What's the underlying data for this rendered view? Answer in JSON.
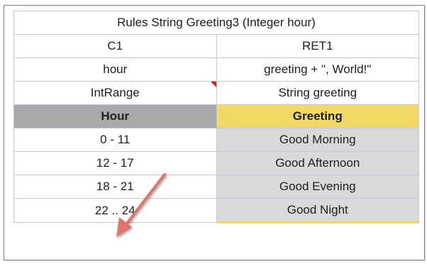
{
  "table": {
    "title": "Rules String Greeting3 (Integer hour)",
    "condition_header": "C1",
    "return_header": "RET1",
    "condition_param": "hour",
    "return_expression": "greeting + \", World!\"",
    "condition_type": "IntRange",
    "return_type": "String greeting",
    "column_hour_label": "Hour",
    "column_greeting_label": "Greeting",
    "rows": [
      {
        "hour": "0 - 11",
        "greeting": "Good Morning"
      },
      {
        "hour": "12 - 17",
        "greeting": "Good Afternoon"
      },
      {
        "hour": "18 - 21",
        "greeting": "Good Evening"
      },
      {
        "hour": "22 .. 24",
        "greeting": "Good Night"
      }
    ]
  },
  "colors": {
    "hour_header_bg": "#a9a9a9",
    "greeting_header_bg": "#f2d967",
    "greeting_cell_bg": "#d9d9d9",
    "comment_marker": "#d61f1f",
    "arrow": "#e0736a"
  },
  "icons": {
    "comment_marker": "comment-indicator-icon",
    "annotation_arrow": "annotation-arrow-icon"
  }
}
